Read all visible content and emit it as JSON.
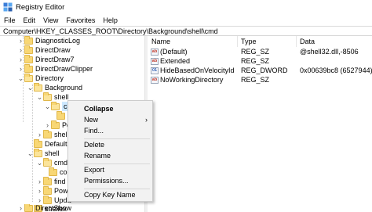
{
  "window": {
    "title": "Registry Editor"
  },
  "menu": [
    "File",
    "Edit",
    "View",
    "Favorites",
    "Help"
  ],
  "address": "Computer\\HKEY_CLASSES_ROOT\\Directory\\Background\\shell\\cmd",
  "tree": [
    {
      "label": "DiagnosticLog"
    },
    {
      "label": "DirectDraw"
    },
    {
      "label": "DirectDraw7"
    },
    {
      "label": "DirectDrawClipper"
    },
    {
      "label": "Directory"
    },
    {
      "label": "Background"
    },
    {
      "label": "shell"
    },
    {
      "label": "cmd"
    },
    {
      "label": ""
    },
    {
      "label": "Po"
    },
    {
      "label": "shelle"
    },
    {
      "label": "Defaultlc"
    },
    {
      "label": "shell"
    },
    {
      "label": "cmd"
    },
    {
      "label": "co"
    },
    {
      "label": "find"
    },
    {
      "label": "Powe"
    },
    {
      "label": "Upda"
    },
    {
      "label": "shellex"
    },
    {
      "label": "DirectShow"
    }
  ],
  "columns": {
    "name": "Name",
    "type": "Type",
    "data": "Data"
  },
  "values": [
    {
      "icon": "ab",
      "name": "(Default)",
      "type": "REG_SZ",
      "data": "@shell32.dll,-8506"
    },
    {
      "icon": "ab",
      "name": "Extended",
      "type": "REG_SZ",
      "data": ""
    },
    {
      "icon": "01",
      "name": "HideBasedOnVelocityId",
      "type": "REG_DWORD",
      "data": "0x00639bc8 (6527944)"
    },
    {
      "icon": "ab",
      "name": "NoWorkingDirectory",
      "type": "REG_SZ",
      "data": ""
    }
  ],
  "context_menu": {
    "collapse": "Collapse",
    "new": "New",
    "find": "Find...",
    "delete": "Delete",
    "rename": "Rename",
    "export": "Export",
    "permissions": "Permissions...",
    "copy_key_name": "Copy Key Name",
    "submenu_arrow": "›"
  },
  "colors": {
    "selection": "#cce8ff",
    "folder": "#f8d775",
    "menu_bg": "#f2f2f2"
  }
}
